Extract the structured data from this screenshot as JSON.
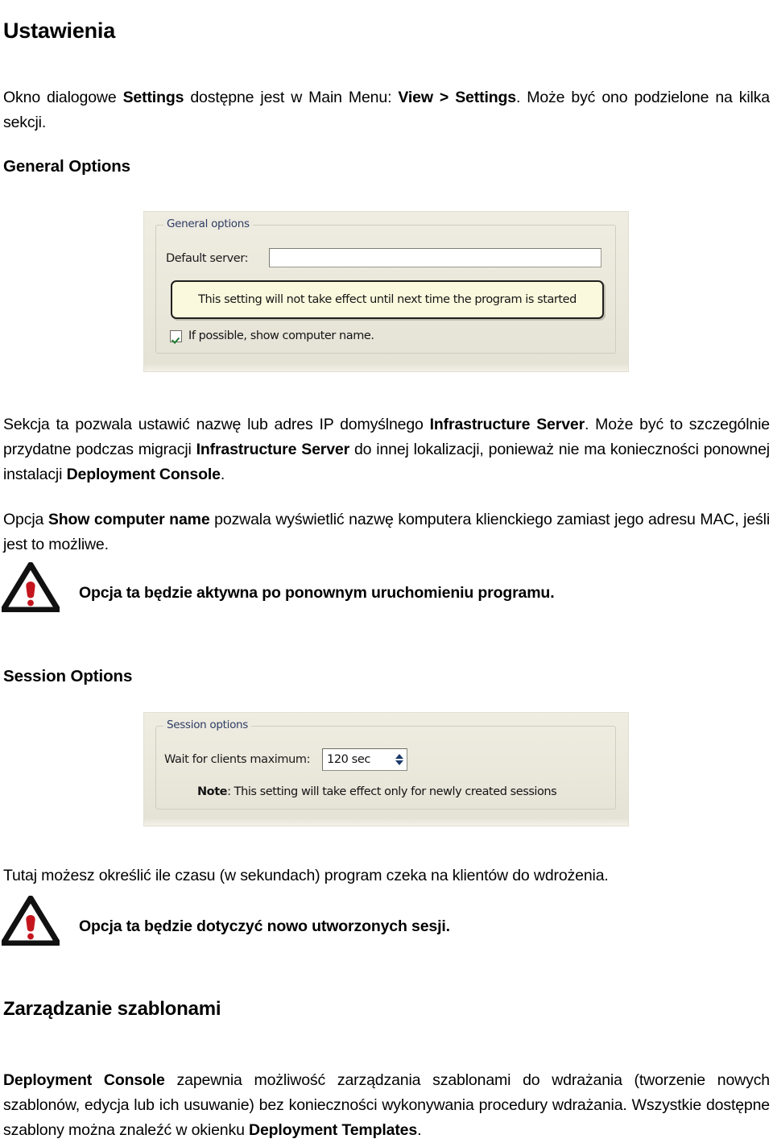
{
  "document": {
    "title": "Ustawienia",
    "intro_paragraph": {
      "part1": "Okno dialogowe ",
      "bold1": "Settings",
      "part2": " dostępne jest w Main Menu: ",
      "bold2": "View > Settings",
      "part3": ". Może być ono podzielone na kilka sekcji."
    }
  },
  "general_options": {
    "heading": "General Options",
    "screenshot": {
      "groupbox_legend": "General options",
      "default_server_label": "Default server:",
      "default_server_value": "",
      "info_box_text": "This setting will not take effect until next time the program is started",
      "checkbox_label": "If possible, show computer name.",
      "checkbox_checked": true
    },
    "paragraph1": {
      "part1": "Sekcja ta pozwala ustawić nazwę lub adres IP domyślnego ",
      "bold1": "Infrastructure Server",
      "part2": ". Może być to szczególnie przydatne podczas migracji ",
      "bold2": "Infrastructure Server",
      "part3": " do innej lokalizacji, ponieważ nie ma konieczności ponownej instalacji ",
      "bold3": "Deployment Console",
      "part4": "."
    },
    "paragraph2": {
      "part1": "Opcja ",
      "bold1": "Show computer name",
      "part2": " pozwala wyświetlić nazwę komputera klienckiego zamiast jego adresu MAC, jeśli jest to możliwe."
    },
    "warning_note": "Opcja ta będzie aktywna po ponownym uruchomieniu programu.",
    "warning_icon": "warning-triangle-icon"
  },
  "session_options": {
    "heading": "Session Options",
    "screenshot": {
      "groupbox_legend": "Session options",
      "wait_label": "Wait for clients maximum:",
      "wait_value": "120 sec",
      "note_bold": "Note",
      "note_rest": ": This setting will take effect only for newly created sessions"
    },
    "paragraph1": "Tutaj możesz określić ile czasu (w sekundach) program czeka na klientów do wdrożenia.",
    "warning_note": "Opcja ta będzie dotyczyć nowo utworzonych sesji.",
    "warning_icon": "warning-triangle-icon"
  },
  "templates_section": {
    "heading": "Zarządzanie szablonami",
    "paragraph": {
      "bold1": "Deployment Console",
      "part1": " zapewnia możliwość zarządzania szablonami do wdrażania (tworzenie nowych szablonów, edycja lub ich usuwanie) bez konieczności wykonywania procedury wdrażania. Wszystkie dostępne szablony można znaleźć w okienku ",
      "bold2": "Deployment Templates",
      "part2": "."
    }
  },
  "colors": {
    "warning_red": "#c5161f",
    "dialog_bg": "#ece9dd",
    "info_box_bg": "#fbf9dd",
    "legend_blue": "#2d3c63",
    "check_green": "#1f7a2e"
  }
}
